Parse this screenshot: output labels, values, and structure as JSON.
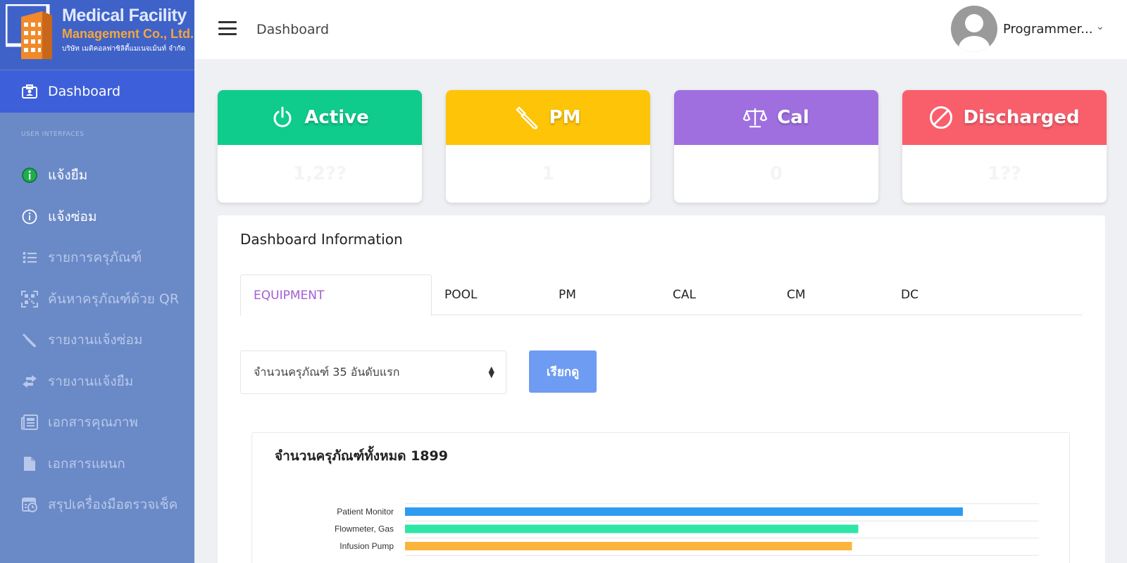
{
  "logo": {
    "line1": "Medical Facility",
    "line2": "Management Co., Ltd.",
    "line3": "บริษัท เมดิคอลฟาซิลิตี้แมเนจเม้นท์ จำกัด"
  },
  "sidebar": {
    "active": {
      "label": "Dashboard",
      "icon": "id-card-icon"
    },
    "section_label": "USER INTERFACES",
    "items": [
      {
        "label": "แจ้งยืม",
        "icon": "info-circle-green-icon",
        "bright": true
      },
      {
        "label": "แจ้งซ่อม",
        "icon": "info-circle-icon",
        "bright": true
      },
      {
        "label": "รายการครุภัณฑ์",
        "icon": "list-icon",
        "bright": false
      },
      {
        "label": "ค้นหาครุภัณฑ์ด้วย QR",
        "icon": "qr-code-icon",
        "bright": false
      },
      {
        "label": "รายงานแจ้งซ่อม",
        "icon": "wrench-icon",
        "bright": false
      },
      {
        "label": "รายงานแจ้งยืม",
        "icon": "exchange-arrows-icon",
        "bright": false
      },
      {
        "label": "เอกสารคุณภาพ",
        "icon": "newspaper-icon",
        "bright": false
      },
      {
        "label": "เอกสารแผนก",
        "icon": "file-icon",
        "bright": false
      },
      {
        "label": "สรุปเครื่องมือตรวจเช็ค",
        "icon": "calendar-check-icon",
        "bright": false
      }
    ]
  },
  "topbar": {
    "title": "Dashboard",
    "user_name": "Programmer...",
    "chevron": "⌄"
  },
  "cards": [
    {
      "label": "Active",
      "value": "1,2??",
      "color": "#0fcb8c",
      "icon": "power-icon"
    },
    {
      "label": "PM",
      "value": "1",
      "color": "#fdc408",
      "icon": "wrench-icon"
    },
    {
      "label": "Cal",
      "value": "0",
      "color": "#9f6fe0",
      "icon": "scale-icon"
    },
    {
      "label": "Discharged",
      "value": "1??",
      "color": "#f95f6b",
      "icon": "ban-icon"
    }
  ],
  "panel": {
    "title": "Dashboard Information",
    "tabs": [
      "EQUIPMENT",
      "POOL",
      "PM",
      "CAL",
      "CM",
      "DC"
    ],
    "select_value": "จำนวนครุภัณฑ์ 35 อันดับแรก",
    "query_button": "เรียกดู"
  },
  "chart_data": {
    "type": "bar",
    "orientation": "horizontal",
    "title": "จำนวนครุภัณฑ์ทั้งหมด 1899",
    "categories": [
      "Patient Monitor",
      "Flowmeter, Gas",
      "Infusion Pump"
    ],
    "values": [
      88,
      71.5,
      70.5
    ],
    "colors": [
      "#2f9bf0",
      "#2ee6a6",
      "#fbb43c"
    ],
    "grid": true
  }
}
